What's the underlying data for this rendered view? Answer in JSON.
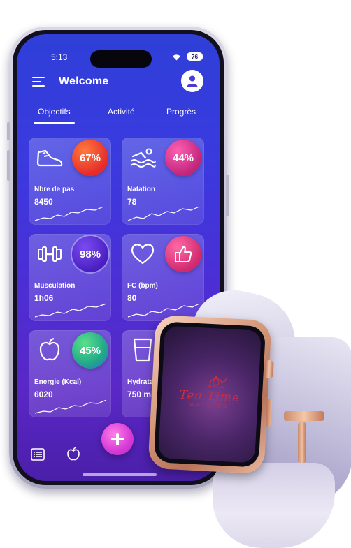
{
  "status": {
    "time": "5:13",
    "battery": "76"
  },
  "header": {
    "title": "Welcome",
    "menu_icon": "hamburger-icon",
    "profile_icon": "user-icon"
  },
  "tabs": [
    "Objectifs",
    "Activité",
    "Progrès"
  ],
  "cards": [
    {
      "label": "Nbre de pas",
      "value": "8450",
      "badge": "67%",
      "icon": "shoe-icon",
      "color": "#ee3a2a"
    },
    {
      "label": "Natation",
      "value": "78",
      "badge": "44%",
      "icon": "swimmer-icon",
      "color": "#e0408e"
    },
    {
      "label": "Musculation",
      "value": "1h06",
      "badge": "98%",
      "icon": "dumbbell-icon",
      "color": "#5a2bd0"
    },
    {
      "label": "FC (bpm)",
      "value": "80",
      "badge": "",
      "icon": "heart-icon",
      "color": "#e23f7e"
    },
    {
      "label": "Energie (Kcal)",
      "value": "6020",
      "badge": "45%",
      "icon": "apple-icon",
      "color": "#2fbe8c"
    },
    {
      "label": "Hydratation",
      "value": "750 ml",
      "badge": "",
      "icon": "glass-icon",
      "color": "#ffffff"
    }
  ],
  "bottom_nav": {
    "fab_icon": "plus-icon",
    "items": [
      "list-icon",
      "apple-icon"
    ]
  },
  "watch": {
    "brand": "Tea Time",
    "subtitle": "WATCHES"
  }
}
